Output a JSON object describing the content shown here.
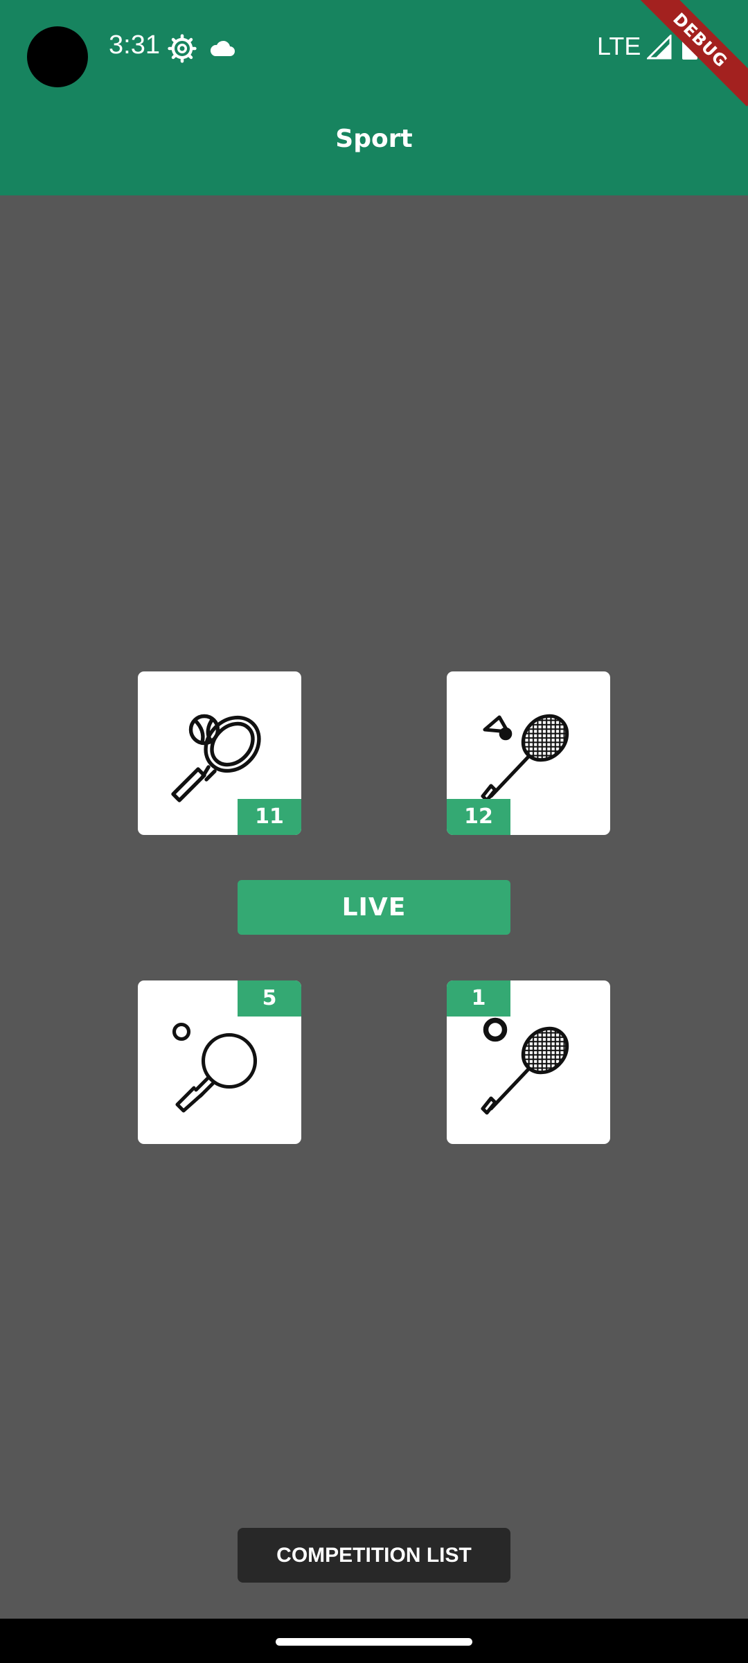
{
  "status_bar": {
    "time": "3:31",
    "network": "LTE",
    "icons": [
      "gear-icon",
      "cloud-icon",
      "signal-icon",
      "battery-icon"
    ]
  },
  "app_bar": {
    "title": "Sport"
  },
  "debug_banner": {
    "label": "DEBUG"
  },
  "sports": [
    {
      "icon": "tennis-racket-ball-icon",
      "count": "11"
    },
    {
      "icon": "badminton-racket-shuttlecock-icon",
      "count": "12"
    },
    {
      "icon": "table-tennis-paddle-icon",
      "count": "5"
    },
    {
      "icon": "squash-racket-ball-icon",
      "count": "1"
    }
  ],
  "live_button": {
    "label": "LIVE"
  },
  "competition_button": {
    "label": "COMPETITION LIST"
  },
  "colors": {
    "primary": "#17845f",
    "accent": "#34a973",
    "background": "#575757",
    "debug": "#a3211f",
    "dark_button": "#282828"
  }
}
